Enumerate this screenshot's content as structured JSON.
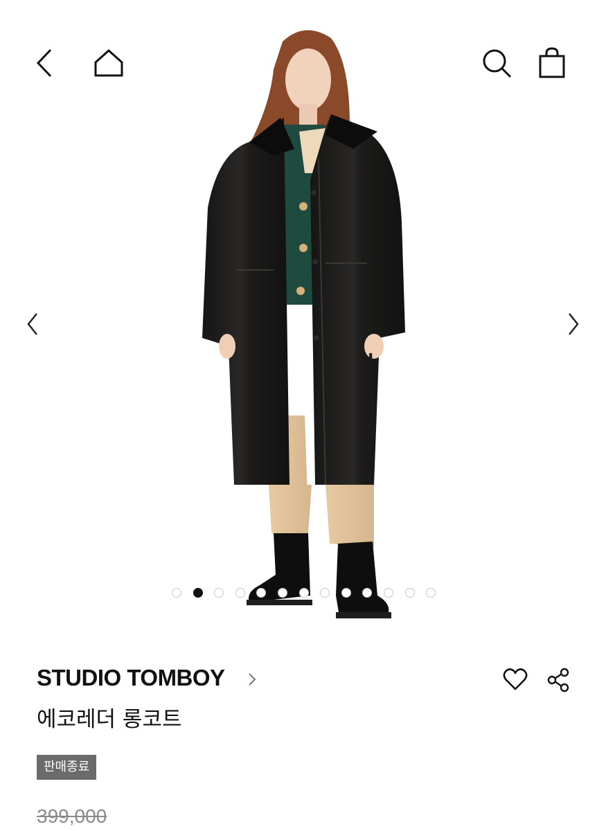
{
  "header": {
    "icons": [
      "back-icon",
      "home-icon",
      "search-icon",
      "shopping-bag-icon"
    ]
  },
  "gallery": {
    "image_alt": "black faux leather long coat product photo",
    "prev_icon": "chevron-left-icon",
    "next_icon": "chevron-right-icon",
    "slide_count": 13,
    "active_index": 1
  },
  "product": {
    "brand": "STUDIO TOMBOY",
    "brand_chevron_icon": "chevron-right-icon",
    "name": "에코레더 롱코트",
    "status_badge": "판매종료",
    "price": "399,000"
  },
  "actions": {
    "icons": [
      "heart-icon",
      "share-icon"
    ]
  },
  "colors": {
    "text": "#111111",
    "badge_bg": "#6b6b6b",
    "price_strikethrough": "#8a8a8a"
  }
}
